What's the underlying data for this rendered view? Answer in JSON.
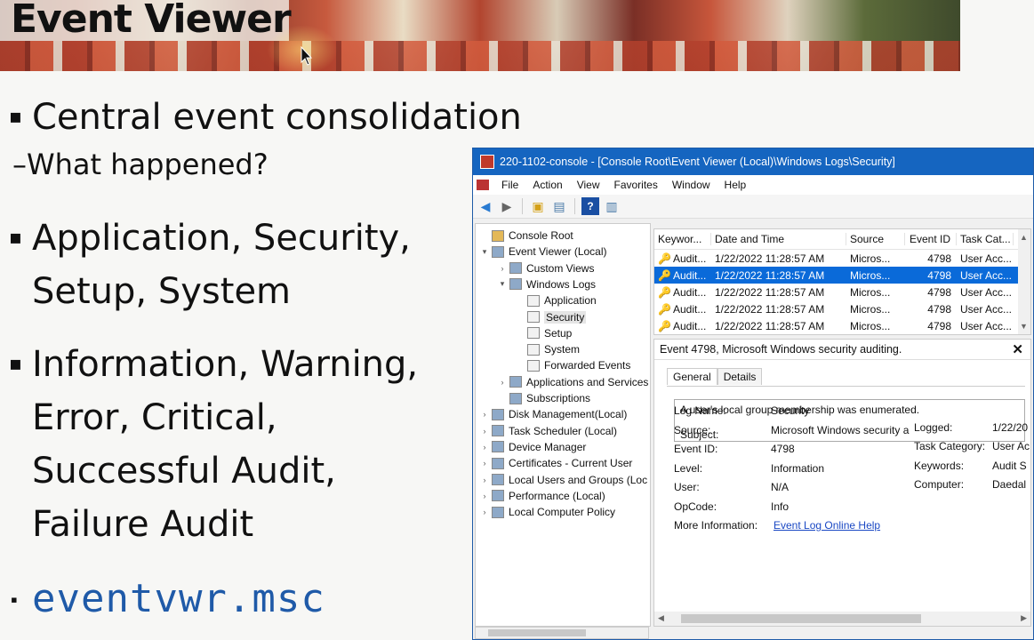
{
  "slide": {
    "title": "Event Viewer",
    "bullets": [
      "Central event consolidation",
      "Application, Security,",
      "Setup, System",
      "Information, Warning,",
      "Error, Critical,",
      "Successful Audit,",
      "Failure Audit"
    ],
    "sub_bullet": "What happened?",
    "sub_dash": "–",
    "bullet_mark": "▪",
    "command": "eventvwr.msc"
  },
  "window": {
    "title": "220-1102-console - [Console Root\\Event Viewer (Local)\\Windows Logs\\Security]",
    "menu": [
      "File",
      "Action",
      "View",
      "Favorites",
      "Window",
      "Help"
    ],
    "tree": [
      {
        "label": "Console Root",
        "level": 0,
        "expander": ""
      },
      {
        "label": "Event Viewer (Local)",
        "level": 1,
        "expander": "▾"
      },
      {
        "label": "Custom Views",
        "level": 2,
        "expander": "›"
      },
      {
        "label": "Windows Logs",
        "level": 2,
        "expander": "▾"
      },
      {
        "label": "Application",
        "level": 3,
        "expander": ""
      },
      {
        "label": "Security",
        "level": 3,
        "expander": "",
        "selected": true
      },
      {
        "label": "Setup",
        "level": 3,
        "expander": ""
      },
      {
        "label": "System",
        "level": 3,
        "expander": ""
      },
      {
        "label": "Forwarded Events",
        "level": 3,
        "expander": ""
      },
      {
        "label": "Applications and Services",
        "level": 2,
        "expander": "›"
      },
      {
        "label": "Subscriptions",
        "level": 2,
        "expander": ""
      },
      {
        "label": "Disk Management(Local)",
        "level": 1,
        "expander": "›"
      },
      {
        "label": "Task Scheduler (Local)",
        "level": 1,
        "expander": "›"
      },
      {
        "label": "Device Manager",
        "level": 1,
        "expander": "›"
      },
      {
        "label": "Certificates - Current User",
        "level": 1,
        "expander": "›"
      },
      {
        "label": "Local Users and Groups (Loc",
        "level": 1,
        "expander": "›"
      },
      {
        "label": "Performance (Local)",
        "level": 1,
        "expander": "›"
      },
      {
        "label": "Local Computer Policy",
        "level": 1,
        "expander": "›"
      }
    ],
    "list": {
      "headers": [
        "Keywor...",
        "Date and Time",
        "Source",
        "Event ID",
        "Task Cat..."
      ],
      "rows": [
        [
          "Audit...",
          "1/22/2022 11:28:57 AM",
          "Micros...",
          "4798",
          "User Acc..."
        ],
        [
          "Audit...",
          "1/22/2022 11:28:57 AM",
          "Micros...",
          "4798",
          "User Acc..."
        ],
        [
          "Audit...",
          "1/22/2022 11:28:57 AM",
          "Micros...",
          "4798",
          "User Acc..."
        ],
        [
          "Audit...",
          "1/22/2022 11:28:57 AM",
          "Micros...",
          "4798",
          "User Acc..."
        ],
        [
          "Audit...",
          "1/22/2022 11:28:57 AM",
          "Micros...",
          "4798",
          "User Acc..."
        ]
      ],
      "selected_index": 1
    },
    "detail": {
      "header": "Event 4798, Microsoft Windows security auditing.",
      "tabs": [
        "General",
        "Details"
      ],
      "description": "A user's local group membership was enumerated.",
      "description_line2": "Subject:",
      "fields_left": [
        {
          "label": "Log Name:",
          "value": "Security"
        },
        {
          "label": "Source:",
          "value": "Microsoft Windows security a"
        },
        {
          "label": "Event ID:",
          "value": "4798"
        },
        {
          "label": "Level:",
          "value": "Information"
        },
        {
          "label": "User:",
          "value": "N/A"
        },
        {
          "label": "OpCode:",
          "value": "Info"
        },
        {
          "label": "More Information:",
          "value": "Event Log Online Help"
        }
      ],
      "fields_right": [
        {
          "label": "Logged:",
          "value": "1/22/20"
        },
        {
          "label": "Task Category:",
          "value": "User Ac"
        },
        {
          "label": "Keywords:",
          "value": "Audit S"
        },
        {
          "label": "Computer:",
          "value": "Daedal"
        }
      ]
    }
  }
}
